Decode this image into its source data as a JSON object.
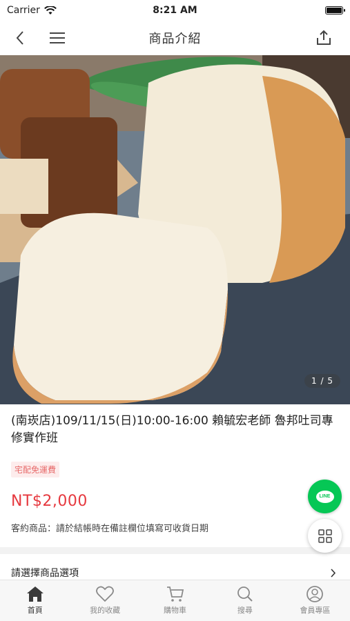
{
  "status_bar": {
    "carrier": "Carrier",
    "time": "8:21 AM"
  },
  "nav": {
    "title": "商品介紹"
  },
  "gallery": {
    "counter": "1 / 5"
  },
  "product": {
    "title": "(南崁店)109/11/15(日)10:00-16:00 賴毓宏老師 魯邦吐司專修實作班",
    "tag": "宅配免運費",
    "price": "NT$2,000",
    "note": "客約商品：請於結帳時在備註欄位填寫可收貨日期"
  },
  "options": {
    "label": "請選擇商品選項"
  },
  "fab": {
    "line_label": "LINE"
  },
  "tabs": [
    {
      "label": "首頁",
      "icon": "home-icon",
      "active": true
    },
    {
      "label": "我的收藏",
      "icon": "heart-icon",
      "active": false
    },
    {
      "label": "購物車",
      "icon": "cart-icon",
      "active": false
    },
    {
      "label": "搜尋",
      "icon": "search-icon",
      "active": false
    },
    {
      "label": "會員專區",
      "icon": "user-icon",
      "active": false
    }
  ],
  "colors": {
    "price": "#e6393f",
    "tag": "#e76a6a",
    "line_green": "#06c755"
  }
}
